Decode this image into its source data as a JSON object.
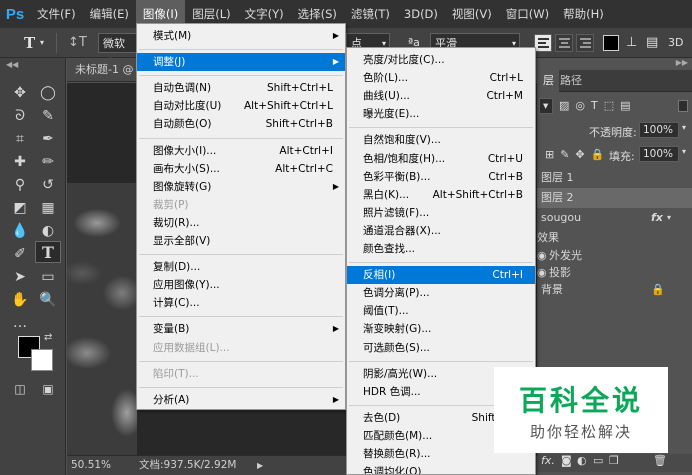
{
  "app": {
    "logo": "Ps"
  },
  "menubar": {
    "items": [
      "文件(F)",
      "编辑(E)",
      "图像(I)",
      "图层(L)",
      "文字(Y)",
      "选择(S)",
      "滤镜(T)",
      "3D(D)",
      "视图(V)",
      "窗口(W)",
      "帮助(H)"
    ],
    "active": "图像(I)"
  },
  "options_bar": {
    "type_tool_icon": "T",
    "orientation_icon": "orientation-icon",
    "font_family": "微软雅",
    "font_size_suffix": "点",
    "aa_icon": "ªa",
    "antialias": "平滑",
    "color_swatch": "#000000"
  },
  "document": {
    "tab_title": "未标题-1 @",
    "zoom": "50.51%",
    "doc_size": "文档:937.5K/2.92M"
  },
  "image_menu": {
    "items": [
      {
        "label": "模式(M)",
        "shortcut": "",
        "submenu": true
      },
      {
        "sep": true
      },
      {
        "label": "调整(J)",
        "shortcut": "",
        "submenu": true,
        "highlighted": true
      },
      {
        "sep": true
      },
      {
        "label": "自动色调(N)",
        "shortcut": "Shift+Ctrl+L"
      },
      {
        "label": "自动对比度(U)",
        "shortcut": "Alt+Shift+Ctrl+L"
      },
      {
        "label": "自动颜色(O)",
        "shortcut": "Shift+Ctrl+B"
      },
      {
        "sep": true
      },
      {
        "label": "图像大小(I)...",
        "shortcut": "Alt+Ctrl+I"
      },
      {
        "label": "画布大小(S)...",
        "shortcut": "Alt+Ctrl+C"
      },
      {
        "label": "图像旋转(G)",
        "shortcut": "",
        "submenu": true
      },
      {
        "label": "裁剪(P)",
        "shortcut": "",
        "disabled": true
      },
      {
        "label": "裁切(R)...",
        "shortcut": ""
      },
      {
        "label": "显示全部(V)",
        "shortcut": ""
      },
      {
        "sep": true
      },
      {
        "label": "复制(D)...",
        "shortcut": ""
      },
      {
        "label": "应用图像(Y)...",
        "shortcut": ""
      },
      {
        "label": "计算(C)...",
        "shortcut": ""
      },
      {
        "sep": true
      },
      {
        "label": "变量(B)",
        "shortcut": "",
        "submenu": true
      },
      {
        "label": "应用数据组(L)...",
        "shortcut": "",
        "disabled": true
      },
      {
        "sep": true
      },
      {
        "label": "陷印(T)...",
        "shortcut": "",
        "disabled": true
      },
      {
        "sep": true
      },
      {
        "label": "分析(A)",
        "shortcut": "",
        "submenu": true
      }
    ]
  },
  "adjust_menu": {
    "items": [
      {
        "label": "亮度/对比度(C)...",
        "shortcut": ""
      },
      {
        "label": "色阶(L)...",
        "shortcut": "Ctrl+L"
      },
      {
        "label": "曲线(U)...",
        "shortcut": "Ctrl+M"
      },
      {
        "label": "曝光度(E)...",
        "shortcut": ""
      },
      {
        "sep": true
      },
      {
        "label": "自然饱和度(V)...",
        "shortcut": ""
      },
      {
        "label": "色相/饱和度(H)...",
        "shortcut": "Ctrl+U"
      },
      {
        "label": "色彩平衡(B)...",
        "shortcut": "Ctrl+B"
      },
      {
        "label": "黑白(K)...",
        "shortcut": "Alt+Shift+Ctrl+B"
      },
      {
        "label": "照片滤镜(F)...",
        "shortcut": ""
      },
      {
        "label": "通道混合器(X)...",
        "shortcut": ""
      },
      {
        "label": "颜色查找...",
        "shortcut": ""
      },
      {
        "sep": true
      },
      {
        "label": "反相(I)",
        "shortcut": "Ctrl+I",
        "highlighted": true
      },
      {
        "label": "色调分离(P)...",
        "shortcut": ""
      },
      {
        "label": "阈值(T)...",
        "shortcut": ""
      },
      {
        "label": "渐变映射(G)...",
        "shortcut": ""
      },
      {
        "label": "可选颜色(S)...",
        "shortcut": ""
      },
      {
        "sep": true
      },
      {
        "label": "阴影/高光(W)...",
        "shortcut": ""
      },
      {
        "label": "HDR 色调...",
        "shortcut": ""
      },
      {
        "sep": true
      },
      {
        "label": "去色(D)",
        "shortcut": "Shift+Ctrl"
      },
      {
        "label": "匹配颜色(M)...",
        "shortcut": ""
      },
      {
        "label": "替换颜色(R)...",
        "shortcut": ""
      },
      {
        "label": "色调均化(Q)",
        "shortcut": ""
      }
    ]
  },
  "layers_panel": {
    "tabs": [
      "层",
      "路径"
    ],
    "opacity_label": "不透明度:",
    "opacity_value": "100%",
    "fill_label": "填充:",
    "fill_value": "100%",
    "layers": [
      {
        "name": "图层 1",
        "selected": false
      },
      {
        "name": "图层 2",
        "selected": true
      },
      {
        "name": "sougou",
        "fx": "fx"
      },
      {
        "name": "效果"
      },
      {
        "name": "外发光"
      },
      {
        "name": "投影"
      },
      {
        "name": "背景"
      }
    ]
  },
  "watermark": {
    "title": "百科全说",
    "subtitle": "助你轻松解决"
  },
  "colors": {
    "menu_highlight": "#0078d7",
    "menubar": "#323232",
    "panel": "#535353",
    "watermark_green": "#0aa858"
  }
}
